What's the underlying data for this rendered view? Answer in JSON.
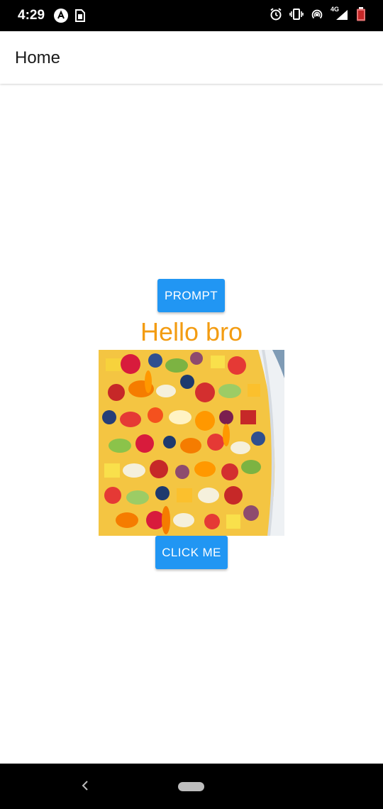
{
  "status_bar": {
    "time": "4:29",
    "network_label": "4G",
    "icons": [
      "notification-a-icon",
      "sim-icon",
      "alarm-icon",
      "vibrate-icon",
      "hotspot-icon",
      "signal-icon",
      "battery-icon"
    ]
  },
  "app_bar": {
    "title": "Home"
  },
  "main": {
    "prompt_button_label": "PROMPT",
    "greeting": "Hello bro",
    "image_subject": "fruit-salad-bowl",
    "click_button_label": "CLICK ME"
  },
  "colors": {
    "primary_button": "#2196f3",
    "greeting_text": "#f39c12",
    "status_bar": "#000000",
    "nav_bar": "#000000"
  },
  "nav_bar": {
    "icons": [
      "back-icon",
      "home-pill-icon"
    ]
  }
}
